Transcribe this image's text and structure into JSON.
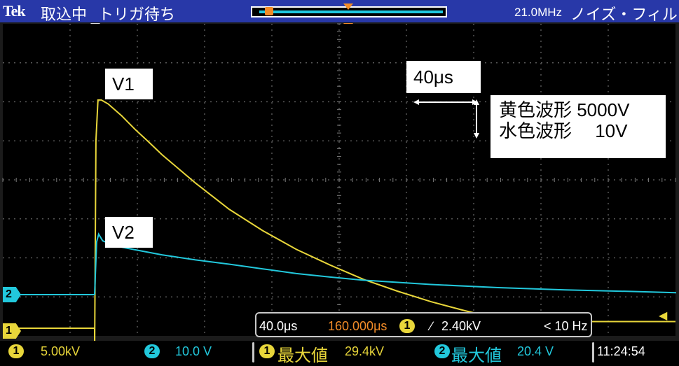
{
  "app": {
    "brand": "Tek"
  },
  "header": {
    "acq_status": "取込中",
    "trigger_status": "トリガ待ち",
    "bandwidth": "21.0MHz",
    "filter": "ノイズ・フィルタ"
  },
  "annotations": {
    "v1": "V1",
    "v2": "V2",
    "time_scale": "40μs",
    "legend_line1": "黄色波形 5000V",
    "legend_line2": "水色波形 　10V"
  },
  "channels": {
    "ch1_marker": "1",
    "ch2_marker": "2",
    "ch1_color": "#e8d63a",
    "ch2_color": "#22c8dc"
  },
  "horizontal": {
    "scale": "40.0μs",
    "position": "160.000μs"
  },
  "trigger": {
    "source": "1",
    "slope": "∕",
    "level": "2.40kV",
    "freq": "< 10 Hz"
  },
  "status": {
    "ch1_num": "1",
    "ch1_scale": "5.00kV",
    "ch2_num": "2",
    "ch2_scale": "10.0 V",
    "meas1_num": "1",
    "meas1_label": "最大値",
    "meas1_value": "29.4kV",
    "meas2_num": "2",
    "meas2_label": "最大値",
    "meas2_value": "20.4 V",
    "time": "11:24:54"
  },
  "chart_data": {
    "type": "line",
    "x_divisions": 10,
    "y_divisions": 8,
    "series": [
      {
        "name": "V1",
        "color": "#e8d63a",
        "x_div": [
          0,
          0.02,
          0.05,
          0.1,
          0.2,
          0.4,
          0.6,
          0.8,
          1.0,
          1.5,
          2.0,
          2.5,
          3.0,
          3.5,
          4.0,
          4.5,
          5.0,
          5.5,
          6.0,
          6.2,
          7.0,
          8.0
        ],
        "y_div": [
          -0.7,
          4.8,
          5.85,
          5.85,
          5.75,
          5.45,
          5.1,
          4.78,
          4.45,
          3.72,
          3.05,
          2.5,
          2.02,
          1.62,
          1.25,
          0.95,
          0.68,
          0.45,
          0.25,
          0.17,
          0.17,
          0.17
        ]
      },
      {
        "name": "V2",
        "color": "#22c8dc",
        "x_div": [
          0,
          0.03,
          0.06,
          0.12,
          0.3,
          0.6,
          1.0,
          1.5,
          2.0,
          2.5,
          3.0,
          3.5,
          4.0,
          5.0,
          6.0,
          7.0,
          8.0,
          9.0,
          10.0
        ],
        "y_div": [
          0,
          1.35,
          1.55,
          1.38,
          1.25,
          1.15,
          1.02,
          0.89,
          0.78,
          0.66,
          0.54,
          0.45,
          0.37,
          0.26,
          0.18,
          0.12,
          0.08,
          0.05,
          0.03
        ]
      }
    ]
  }
}
